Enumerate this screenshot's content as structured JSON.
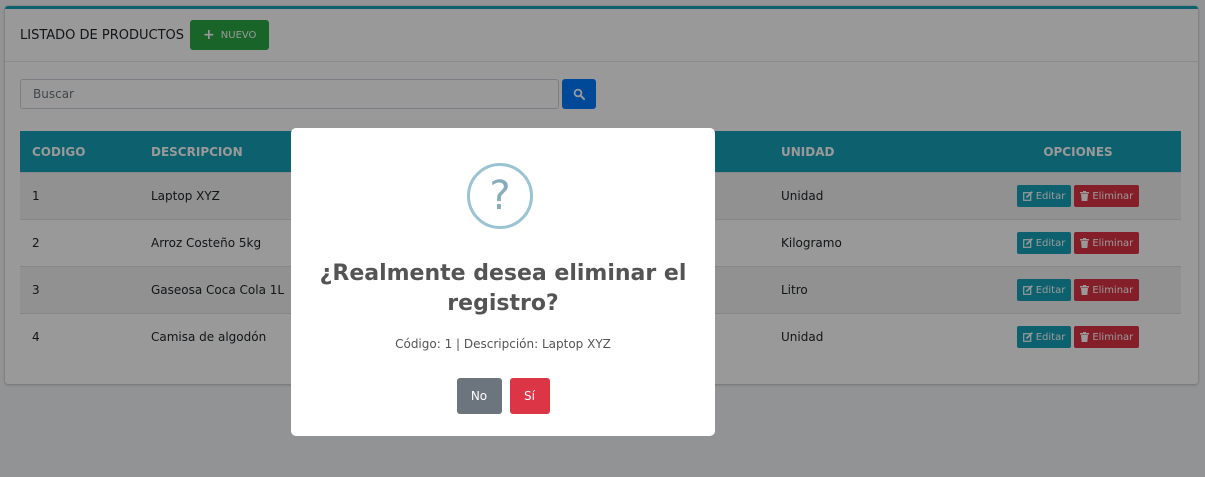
{
  "header": {
    "title": "LISTADO DE PRODUCTOS",
    "new_label": "NUEVO"
  },
  "search": {
    "placeholder": "Buscar"
  },
  "table": {
    "columns": [
      "CODIGO",
      "DESCRIPCION",
      "UNIDAD",
      "OPCIONES"
    ],
    "rows": [
      {
        "codigo": "1",
        "descripcion": "Laptop XYZ",
        "unidad": "Unidad"
      },
      {
        "codigo": "2",
        "descripcion": "Arroz Costeño 5kg",
        "unidad": "Kilogramo"
      },
      {
        "codigo": "3",
        "descripcion": "Gaseosa Coca Cola 1L",
        "unidad": "Litro"
      },
      {
        "codigo": "4",
        "descripcion": "Camisa de algodón",
        "unidad": "Unidad"
      }
    ],
    "edit_label": "Editar",
    "delete_label": "Eliminar"
  },
  "modal": {
    "icon": "?",
    "title": "¿Realmente desea eliminar el registro?",
    "text": "Código: 1 | Descripción: Laptop XYZ",
    "no_label": "No",
    "yes_label": "Sí"
  },
  "colors": {
    "accent": "#17a2b8",
    "success": "#28a745",
    "primary": "#007bff",
    "danger": "#dc3545",
    "secondary": "#6c757d"
  }
}
